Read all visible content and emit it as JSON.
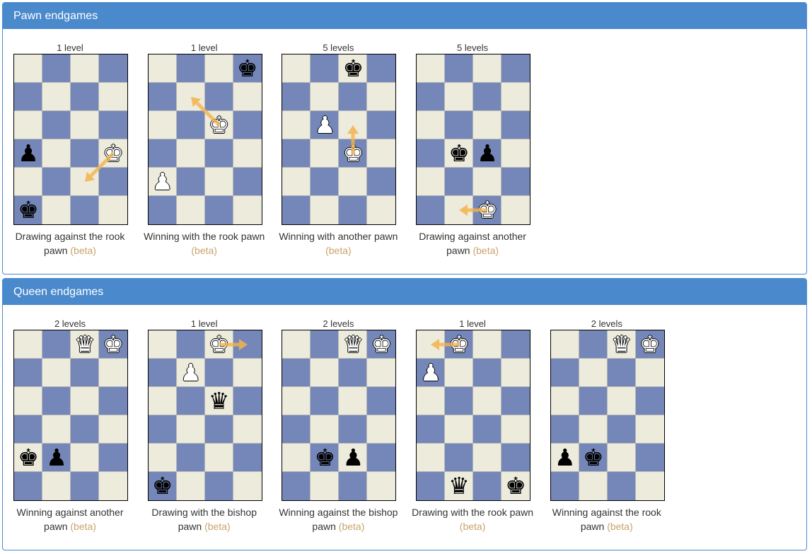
{
  "colors": {
    "header_bg": "#4a89cc",
    "light_square": "#ecebdc",
    "dark_square": "#7587b8",
    "beta_text": "#c8a36a",
    "arrow": "#f5b34a"
  },
  "sections": [
    {
      "title": "Pawn endgames",
      "tiles": [
        {
          "levels": "1 level",
          "caption": "Drawing against the rook pawn",
          "beta": "(beta)",
          "pieces": [
            {
              "row": 3,
              "col": 0,
              "color": "black",
              "type": "pawn",
              "glyph": "♟"
            },
            {
              "row": 3,
              "col": 3,
              "color": "white",
              "type": "king",
              "glyph": "♚"
            },
            {
              "row": 5,
              "col": 0,
              "color": "black",
              "type": "king",
              "glyph": "♚"
            }
          ],
          "arrow": {
            "from": [
              3,
              3
            ],
            "to": [
              4,
              2
            ]
          }
        },
        {
          "levels": "1 level",
          "caption": "Winning with the rook pawn",
          "beta": "(beta)",
          "pieces": [
            {
              "row": 0,
              "col": 3,
              "color": "black",
              "type": "king",
              "glyph": "♚"
            },
            {
              "row": 2,
              "col": 2,
              "color": "white",
              "type": "king",
              "glyph": "♚"
            },
            {
              "row": 4,
              "col": 0,
              "color": "white",
              "type": "pawn",
              "glyph": "♟"
            }
          ],
          "arrow": {
            "from": [
              2,
              2
            ],
            "to": [
              1,
              1
            ]
          }
        },
        {
          "levels": "5 levels",
          "caption": "Winning with another pawn",
          "beta": "(beta)",
          "pieces": [
            {
              "row": 0,
              "col": 2,
              "color": "black",
              "type": "king",
              "glyph": "♚"
            },
            {
              "row": 2,
              "col": 1,
              "color": "white",
              "type": "pawn",
              "glyph": "♟"
            },
            {
              "row": 3,
              "col": 2,
              "color": "white",
              "type": "king",
              "glyph": "♚"
            }
          ],
          "arrow": {
            "from": [
              3,
              2
            ],
            "to": [
              2,
              2
            ]
          }
        },
        {
          "levels": "5 levels",
          "caption": "Drawing against another pawn",
          "beta": "(beta)",
          "pieces": [
            {
              "row": 3,
              "col": 1,
              "color": "black",
              "type": "king",
              "glyph": "♚"
            },
            {
              "row": 3,
              "col": 2,
              "color": "black",
              "type": "pawn",
              "glyph": "♟"
            },
            {
              "row": 5,
              "col": 2,
              "color": "white",
              "type": "king",
              "glyph": "♚"
            }
          ],
          "arrow": {
            "from": [
              5,
              2
            ],
            "to": [
              5,
              1
            ]
          }
        }
      ]
    },
    {
      "title": "Queen endgames",
      "tiles": [
        {
          "levels": "2 levels",
          "caption": "Winning against another pawn",
          "beta": "(beta)",
          "pieces": [
            {
              "row": 0,
              "col": 2,
              "color": "white",
              "type": "queen",
              "glyph": "♛"
            },
            {
              "row": 0,
              "col": 3,
              "color": "white",
              "type": "king",
              "glyph": "♚"
            },
            {
              "row": 4,
              "col": 0,
              "color": "black",
              "type": "king",
              "glyph": "♚"
            },
            {
              "row": 4,
              "col": 1,
              "color": "black",
              "type": "pawn",
              "glyph": "♟"
            }
          ],
          "arrow": null
        },
        {
          "levels": "1 level",
          "caption": "Drawing with the bishop pawn",
          "beta": "(beta)",
          "pieces": [
            {
              "row": 0,
              "col": 2,
              "color": "white",
              "type": "king",
              "glyph": "♚"
            },
            {
              "row": 1,
              "col": 1,
              "color": "white",
              "type": "pawn",
              "glyph": "♟"
            },
            {
              "row": 2,
              "col": 2,
              "color": "black",
              "type": "queen",
              "glyph": "♛"
            },
            {
              "row": 5,
              "col": 0,
              "color": "black",
              "type": "king",
              "glyph": "♚"
            }
          ],
          "arrow": {
            "from": [
              0,
              2
            ],
            "to": [
              0,
              3
            ]
          }
        },
        {
          "levels": "2 levels",
          "caption": "Winning against the bishop pawn",
          "beta": "(beta)",
          "pieces": [
            {
              "row": 0,
              "col": 2,
              "color": "white",
              "type": "queen",
              "glyph": "♛"
            },
            {
              "row": 0,
              "col": 3,
              "color": "white",
              "type": "king",
              "glyph": "♚"
            },
            {
              "row": 4,
              "col": 1,
              "color": "black",
              "type": "king",
              "glyph": "♚"
            },
            {
              "row": 4,
              "col": 2,
              "color": "black",
              "type": "pawn",
              "glyph": "♟"
            }
          ],
          "arrow": null
        },
        {
          "levels": "1 level",
          "caption": "Drawing with the rook pawn",
          "beta": "(beta)",
          "pieces": [
            {
              "row": 0,
              "col": 1,
              "color": "white",
              "type": "king",
              "glyph": "♚"
            },
            {
              "row": 1,
              "col": 0,
              "color": "white",
              "type": "pawn",
              "glyph": "♟"
            },
            {
              "row": 5,
              "col": 1,
              "color": "black",
              "type": "queen",
              "glyph": "♛"
            },
            {
              "row": 5,
              "col": 3,
              "color": "black",
              "type": "king",
              "glyph": "♚"
            }
          ],
          "arrow": {
            "from": [
              0,
              1
            ],
            "to": [
              0,
              0
            ]
          }
        },
        {
          "levels": "2 levels",
          "caption": "Winning against the rook pawn",
          "beta": "(beta)",
          "pieces": [
            {
              "row": 0,
              "col": 2,
              "color": "white",
              "type": "queen",
              "glyph": "♛"
            },
            {
              "row": 0,
              "col": 3,
              "color": "white",
              "type": "king",
              "glyph": "♚"
            },
            {
              "row": 4,
              "col": 0,
              "color": "black",
              "type": "pawn",
              "glyph": "♟"
            },
            {
              "row": 4,
              "col": 1,
              "color": "black",
              "type": "king",
              "glyph": "♚"
            }
          ],
          "arrow": null
        }
      ]
    }
  ]
}
